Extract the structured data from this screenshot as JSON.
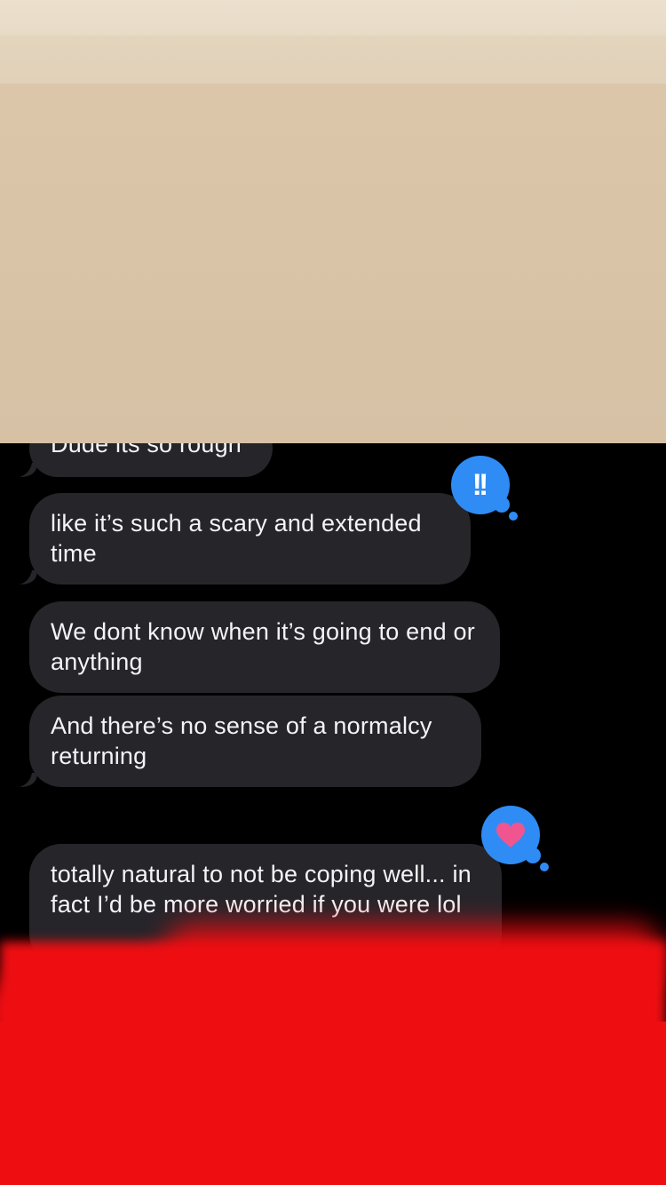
{
  "messages": [
    {
      "text": "Dude its so rough"
    },
    {
      "text": "like it’s such a scary and extended time",
      "reaction": "exclamation"
    },
    {
      "text": "We dont know when it’s going to end or anything"
    },
    {
      "text": "And there’s no sense of a normalcy returning"
    },
    {
      "text": "totally natural to not be coping well... in fact I’d be more worried if you were lol",
      "reaction": "heart"
    }
  ],
  "reactions": {
    "emphasize_glyph": "!!",
    "heart_color": "#f0558f"
  },
  "colors": {
    "received_bubble": "#26252a",
    "reaction_bubble": "#2f8cf4",
    "redaction_red": "#ee0e12",
    "cover_beige": "#d6c1a5"
  }
}
